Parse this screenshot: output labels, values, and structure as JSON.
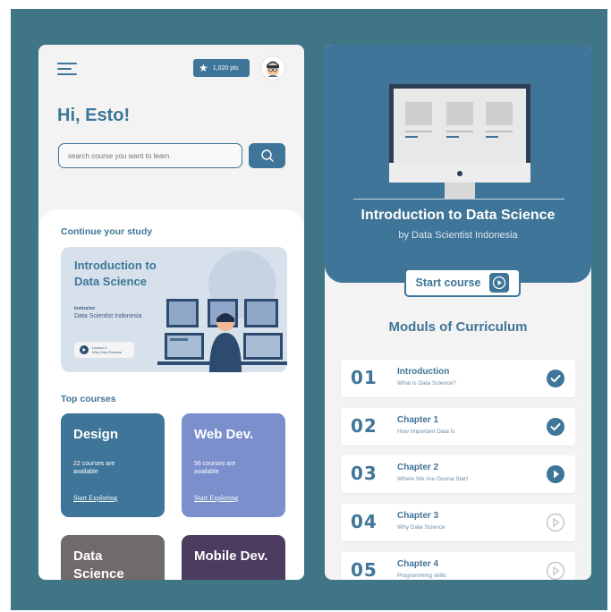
{
  "colors": {
    "primary": "#3f7598",
    "background": "#3f7585",
    "design": "#3f7598",
    "web_dev": "#7a8fcc",
    "data_science": "#706a6a",
    "mobile_dev": "#4c3c60"
  },
  "left": {
    "menu_icon": "hamburger-icon",
    "points": "1,020 pts",
    "greeting": "Hi, Esto!",
    "search": {
      "placeholder": "search course you want to learn"
    },
    "continue": {
      "title": "Continue your study",
      "course_title": "Introduction to Data Science",
      "instructor_label": "Instructor",
      "instructor": "Data Scientist Indonesia",
      "button_line1": "Lesson 3",
      "button_line2": "Why Data Science"
    },
    "top_courses": {
      "title": "Top courses",
      "items": [
        {
          "name": "Design",
          "count": "22 courses are available",
          "link": "Start Exploring",
          "color": "#3f7598"
        },
        {
          "name": "Web Dev.",
          "count": "56 courses are available",
          "link": "Start Exploring",
          "color": "#7a8fcc"
        },
        {
          "name": "Data Science",
          "count": "",
          "link": "",
          "color": "#706a6a"
        },
        {
          "name": "Mobile Dev.",
          "count": "",
          "link": "",
          "color": "#4c3c60"
        }
      ]
    }
  },
  "right": {
    "title": "Introduction to Data Science",
    "subtitle": "by Data Scientist Indonesia",
    "start_button": "Start course",
    "curriculum_title": "Moduls of Curriculum",
    "modules": [
      {
        "num": "01",
        "title": "Introduction",
        "subtitle": "What is Data Science?",
        "status": "completed"
      },
      {
        "num": "02",
        "title": "Chapter 1",
        "subtitle": "How Important Data Is",
        "status": "completed"
      },
      {
        "num": "03",
        "title": "Chapter 2",
        "subtitle": "Where We Are Gonna Start",
        "status": "current"
      },
      {
        "num": "04",
        "title": "Chapter 3",
        "subtitle": "Why Data Science",
        "status": "locked"
      },
      {
        "num": "05",
        "title": "Chapter 4",
        "subtitle": "Programming skills",
        "status": "locked"
      }
    ]
  }
}
